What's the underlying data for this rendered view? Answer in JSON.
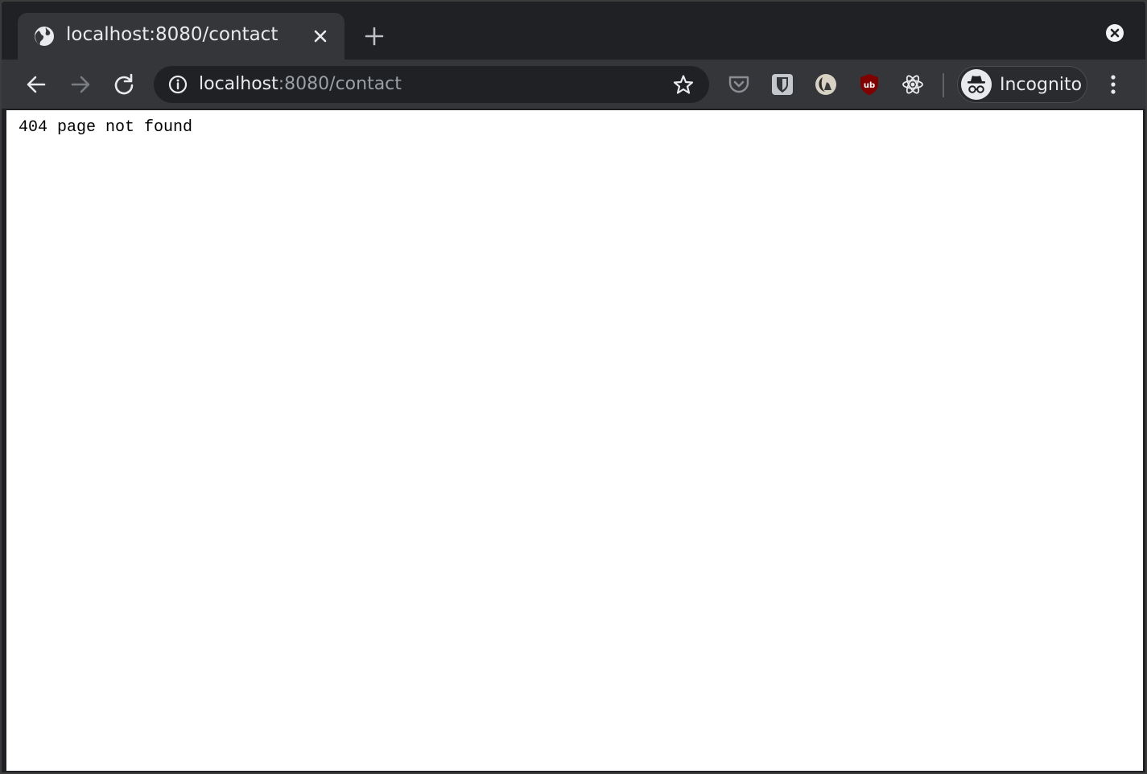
{
  "browser": {
    "tab": {
      "title": "localhost:8080/contact"
    },
    "address_bar": {
      "host": "localhost",
      "path": ":8080/contact"
    },
    "extensions": [
      {
        "name": "pocket-icon"
      },
      {
        "name": "bitwarden-icon"
      },
      {
        "name": "dark-reader-icon"
      },
      {
        "name": "ublock-origin-icon"
      },
      {
        "name": "react-devtools-icon"
      }
    ],
    "profile": {
      "label": "Incognito"
    },
    "colors": {
      "frame": "#202124",
      "toolbar": "#35363a",
      "text": "#e8eaed",
      "muted": "#9aa0a6",
      "ublock_red": "#800000"
    }
  },
  "page": {
    "body_text": "404 page not found"
  }
}
